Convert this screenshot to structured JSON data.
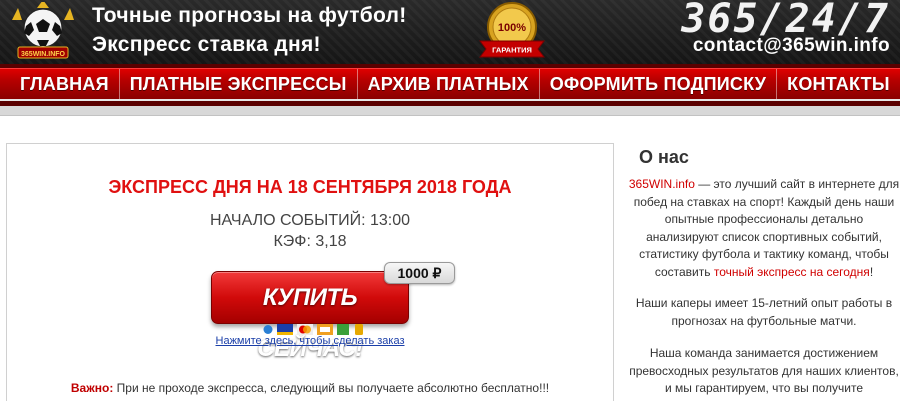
{
  "header": {
    "tagline_line1": "Точные прогнозы на футбол!",
    "tagline_line2": "Экспресс ставка дня!",
    "badge_percent": "100%",
    "badge_label": "ГАРАНТИЯ",
    "logo_text": "365WIN.INFO",
    "phone": "365/24/7",
    "email": "contact@365win.info"
  },
  "nav": {
    "items": [
      "ГЛАВНАЯ",
      "ПЛАТНЫЕ ЭКСПРЕССЫ",
      "АРХИВ ПЛАТНЫХ",
      "ОФОРМИТЬ ПОДПИСКУ",
      "КОНТАКТЫ"
    ]
  },
  "main": {
    "title": "ЭКСПРЕСС ДНЯ НА 18 СЕНТЯБРЯ 2018 ГОДА",
    "start_label": "НАЧАЛО СОБЫТИЙ:",
    "start_time": "13:00",
    "odds_label": "КЭФ:",
    "odds_value": "3,18",
    "buy_label": "КУПИТЬ СЕЙЧАС!",
    "price": "1000 ₽",
    "order_link": "Нажмите здесь, чтобы сделать заказ",
    "note_bold": "Важно:",
    "note_text": "При не проходе экспресса, следующий вы получаете абсолютно бесплатно!!!"
  },
  "sidebar": {
    "title": "О нас",
    "p1_link": "365WIN.info",
    "p1_text": "— это лучший сайт в интернете для побед на ставках на спорт! Каждый день наши опытные профессионалы детально анализируют список спортивных событий, статистику футбола и тактику команд, чтобы составить",
    "p1_link2": "точный экспресс на сегодня",
    "p1_end": "!",
    "p2_text": "Наши каперы имеет 15-летний опыт работы в прогнозах на футбольные матчи.",
    "p3_text": "Наша команда занимается достижением превосходных результатов для наших клиентов, и мы гарантируем, что вы получите"
  },
  "colors": {
    "accent_red": "#e01010",
    "nav_red": "#c00000",
    "link_blue": "#1a3ea8",
    "header_dark": "#1e1e1e"
  }
}
